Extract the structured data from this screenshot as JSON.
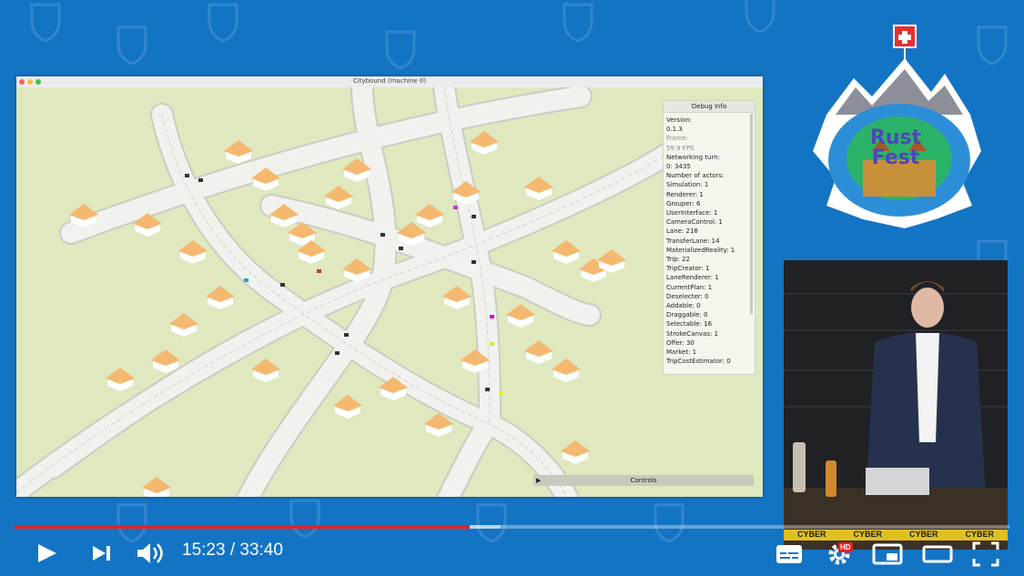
{
  "window": {
    "title": "Citybound (machine 0)",
    "traffic_light_colors": [
      "#fc605b",
      "#fdbc40",
      "#34c84a"
    ]
  },
  "debug": {
    "title": "Debug Info",
    "lines": [
      {
        "text": "Version:",
        "dim": false
      },
      {
        "text": "0.1.3",
        "dim": false
      },
      {
        "text": "Frame:",
        "dim": true
      },
      {
        "text": "59.9 FPS",
        "dim": true
      },
      {
        "text": "Networking turn:",
        "dim": false
      },
      {
        "text": "0: 3435",
        "dim": false
      },
      {
        "text": "Number of actors:",
        "dim": false
      },
      {
        "text": "Simulation: 1",
        "dim": false
      },
      {
        "text": "Renderer: 1",
        "dim": false
      },
      {
        "text": "Grouper: 6",
        "dim": false
      },
      {
        "text": "UserInterface: 1",
        "dim": false
      },
      {
        "text": "CameraControl: 1",
        "dim": false
      },
      {
        "text": "Lane: 218",
        "dim": false
      },
      {
        "text": "TransferLane: 14",
        "dim": false
      },
      {
        "text": "MaterializedReality: 1",
        "dim": false
      },
      {
        "text": "Trip: 22",
        "dim": false
      },
      {
        "text": "TripCreator: 1",
        "dim": false
      },
      {
        "text": "LaneRenderer: 1",
        "dim": false
      },
      {
        "text": "CurrentPlan: 1",
        "dim": false
      },
      {
        "text": "Deselecter: 0",
        "dim": false
      },
      {
        "text": "Addable: 0",
        "dim": false
      },
      {
        "text": "Draggable: 0",
        "dim": false
      },
      {
        "text": "Selectable: 16",
        "dim": false
      },
      {
        "text": "StrokeCanvas: 1",
        "dim": false
      },
      {
        "text": "Offer: 30",
        "dim": false
      },
      {
        "text": "Market: 1",
        "dim": false
      },
      {
        "text": "TripCostEstimator: 0",
        "dim": false
      }
    ]
  },
  "controls_label": "Controls",
  "logo": {
    "line1": "Rust",
    "line2": "Fest"
  },
  "speaker_banner": [
    "CYBER",
    "CYBER",
    "CYBER",
    "CYBER"
  ],
  "player": {
    "current_time": "15:23",
    "separator": " / ",
    "duration": "33:40",
    "progress_fraction": 0.457,
    "buffered_fraction": 0.489,
    "hd_label": "HD",
    "progress_color": "#e52121"
  },
  "colors": {
    "background": "#1474c4",
    "ground": "#dfe8bf",
    "road": "#f2f2f0",
    "house_roof": "#f5b870"
  }
}
